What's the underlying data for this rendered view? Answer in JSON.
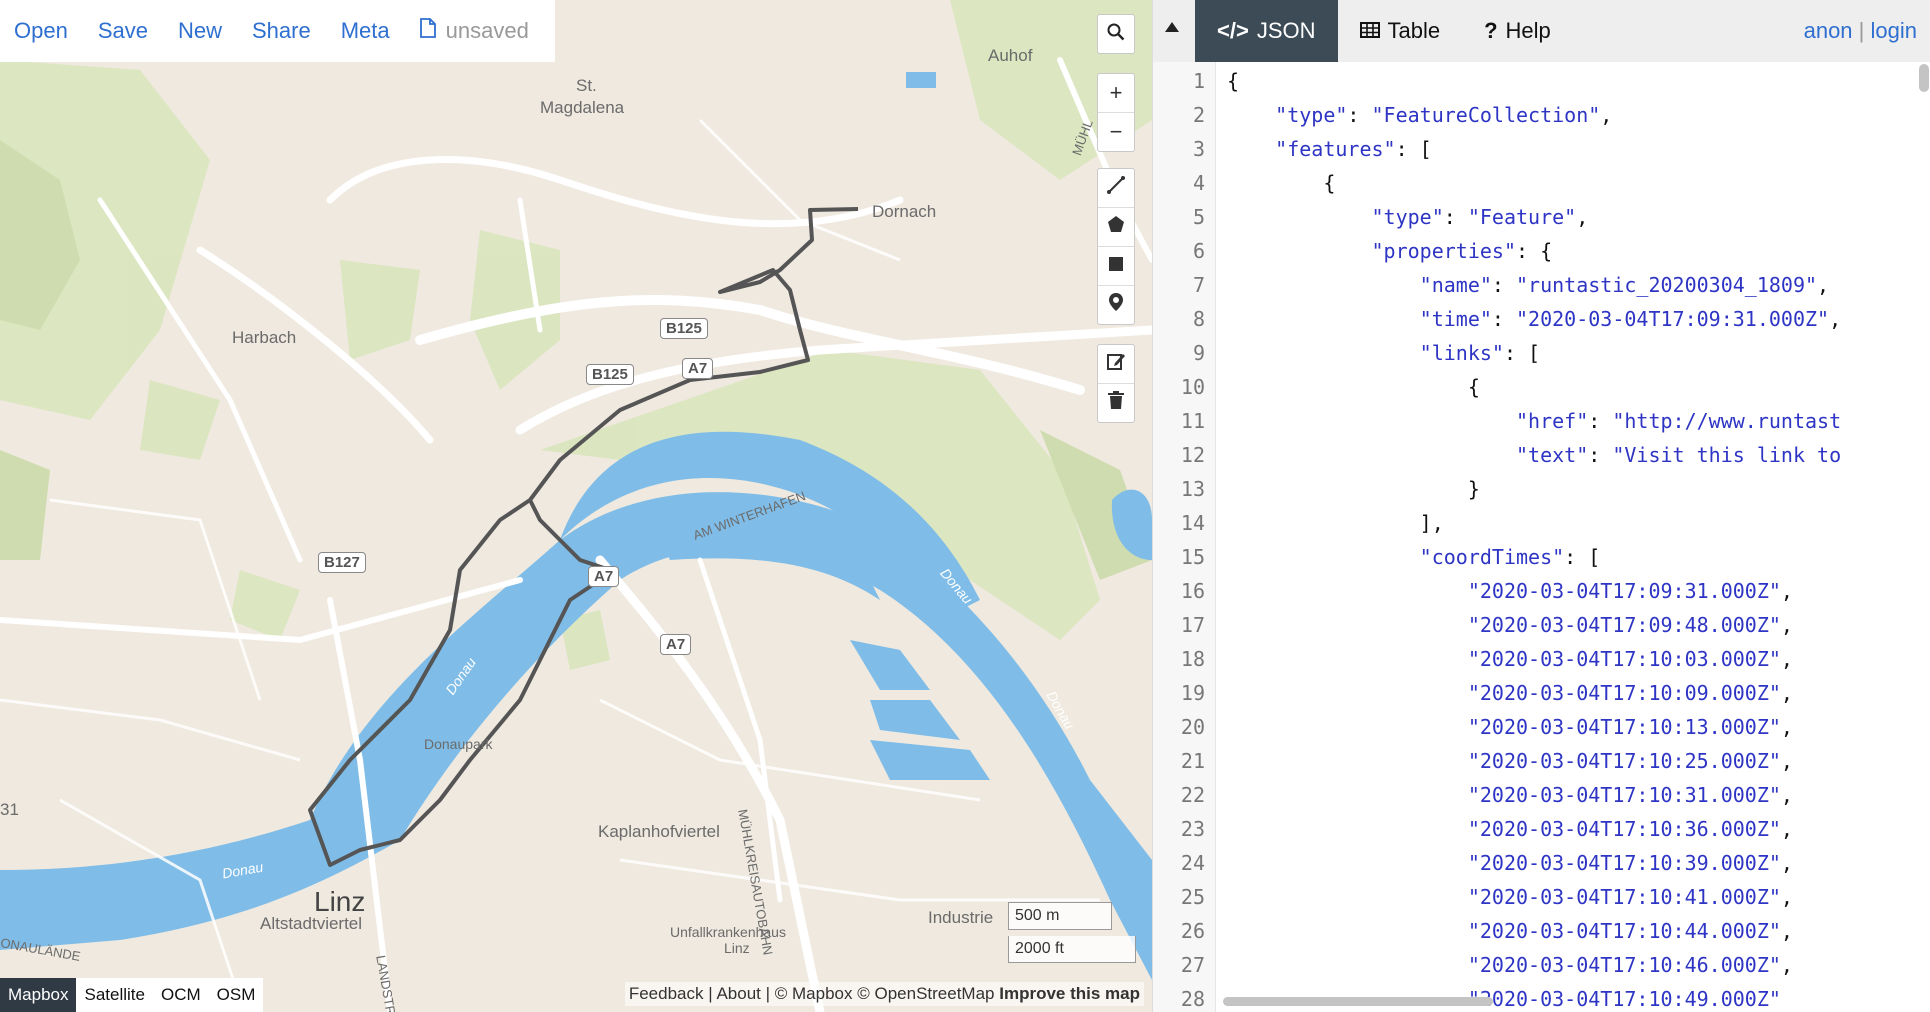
{
  "toolbar": {
    "open_label": "Open",
    "save_label": "Save",
    "new_label": "New",
    "share_label": "Share",
    "meta_label": "Meta",
    "file_status": "unsaved",
    "file_icon": "document-icon"
  },
  "map": {
    "labels": {
      "auhof": "Auhof",
      "st": "St.",
      "magdalena": "Magdalena",
      "dornach": "Dornach",
      "harbach": "Harbach",
      "b125a": "B125",
      "b125b": "B125",
      "a7a": "A7",
      "a7b": "A7",
      "a7c": "A7",
      "b127": "B127",
      "am_winterhafen": "AM WINTERHAFEN",
      "donau1": "Donau",
      "donau2": "Donau",
      "donau3": "Donau",
      "donau4": "Donau",
      "donaupark": "Donaupark",
      "kaplanhofviertel": "Kaplanhofviertel",
      "muehlkreis": "MÜHLKREISAUTOBAHN",
      "linz": "Linz",
      "altstadtviertel": "Altstadtviertel",
      "industrie": "Industrie",
      "unfall": "Unfallkrankenhaus",
      "unfall_linz": "Linz",
      "landstr": "LANDSTR",
      "donaulaende": "ONAULÄNDE",
      "muehl_top": "MÜHL",
      "b31": "31"
    },
    "scale_metric": "500 m",
    "scale_imperial": "2000 ft",
    "layers": [
      "Mapbox",
      "Satellite",
      "OCM",
      "OSM"
    ],
    "active_layer": "Mapbox",
    "attribution": {
      "feedback": "Feedback",
      "about": "About",
      "mapbox": "© Mapbox",
      "osm": "© OpenStreetMap",
      "improve": "Improve this map"
    },
    "colors": {
      "water": "#7fbde8",
      "land": "#efe9df",
      "park": "#d6e4b8",
      "road": "#ffffff",
      "track": "#555555"
    }
  },
  "panel": {
    "tabs": [
      {
        "label": "JSON",
        "icon": "code-icon"
      },
      {
        "label": "Table",
        "icon": "table-icon"
      },
      {
        "label": "Help",
        "icon": "help-icon"
      }
    ],
    "active_tab": "JSON",
    "user": "anon",
    "login": "login",
    "separator": "|"
  },
  "editor": {
    "lines": [
      {
        "n": "1",
        "text": "{"
      },
      {
        "n": "2",
        "text": "    \"type\": \"FeatureCollection\","
      },
      {
        "n": "3",
        "text": "    \"features\": ["
      },
      {
        "n": "4",
        "text": "        {"
      },
      {
        "n": "5",
        "text": "            \"type\": \"Feature\","
      },
      {
        "n": "6",
        "text": "            \"properties\": {"
      },
      {
        "n": "7",
        "text": "                \"name\": \"runtastic_20200304_1809\","
      },
      {
        "n": "8",
        "text": "                \"time\": \"2020-03-04T17:09:31.000Z\","
      },
      {
        "n": "9",
        "text": "                \"links\": ["
      },
      {
        "n": "10",
        "text": "                    {"
      },
      {
        "n": "11",
        "text": "                        \"href\": \"http://www.runtast"
      },
      {
        "n": "12",
        "text": "                        \"text\": \"Visit this link to"
      },
      {
        "n": "13",
        "text": "                    }"
      },
      {
        "n": "14",
        "text": "                ],"
      },
      {
        "n": "15",
        "text": "                \"coordTimes\": ["
      },
      {
        "n": "16",
        "text": "                    \"2020-03-04T17:09:31.000Z\","
      },
      {
        "n": "17",
        "text": "                    \"2020-03-04T17:09:48.000Z\","
      },
      {
        "n": "18",
        "text": "                    \"2020-03-04T17:10:03.000Z\","
      },
      {
        "n": "19",
        "text": "                    \"2020-03-04T17:10:09.000Z\","
      },
      {
        "n": "20",
        "text": "                    \"2020-03-04T17:10:13.000Z\","
      },
      {
        "n": "21",
        "text": "                    \"2020-03-04T17:10:25.000Z\","
      },
      {
        "n": "22",
        "text": "                    \"2020-03-04T17:10:31.000Z\","
      },
      {
        "n": "23",
        "text": "                    \"2020-03-04T17:10:36.000Z\","
      },
      {
        "n": "24",
        "text": "                    \"2020-03-04T17:10:39.000Z\","
      },
      {
        "n": "25",
        "text": "                    \"2020-03-04T17:10:41.000Z\","
      },
      {
        "n": "26",
        "text": "                    \"2020-03-04T17:10:44.000Z\","
      },
      {
        "n": "27",
        "text": "                    \"2020-03-04T17:10:46.000Z\","
      },
      {
        "n": "28",
        "text": "                    \"2020-03-04T17:10:49.000Z\""
      }
    ]
  }
}
